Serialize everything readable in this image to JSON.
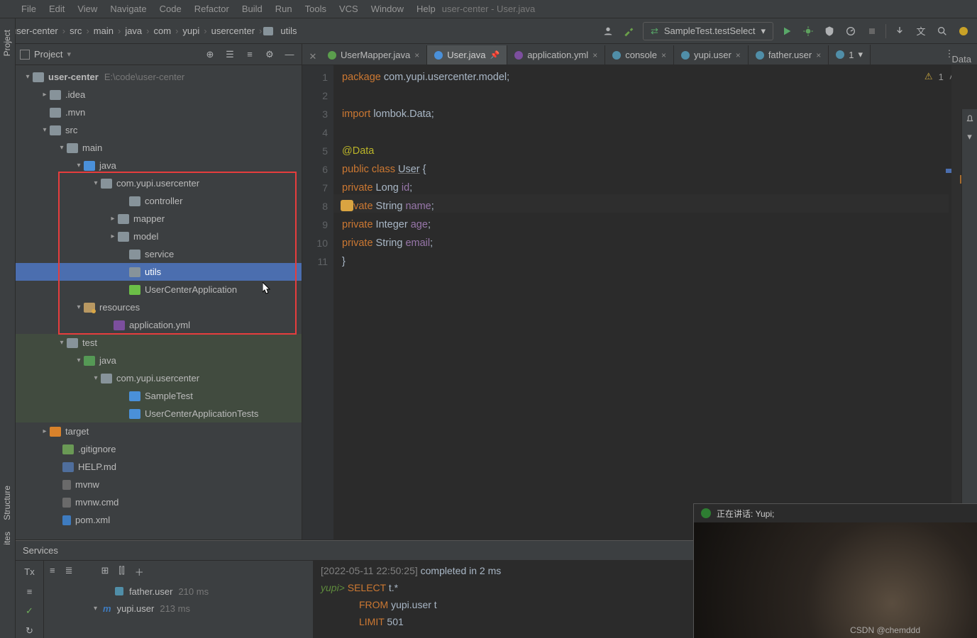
{
  "window_title": "user-center - User.java",
  "menubar": [
    "File",
    "Edit",
    "View",
    "Navigate",
    "Code",
    "Refactor",
    "Build",
    "Run",
    "Tools",
    "VCS",
    "Window",
    "Help"
  ],
  "breadcrumbs": [
    "user-center",
    "src",
    "main",
    "java",
    "com",
    "yupi",
    "usercenter",
    "utils"
  ],
  "run_config": {
    "label": "SampleTest.testSelect"
  },
  "project_panel": {
    "title": "Project",
    "root": {
      "name": "user-center",
      "path": "E:\\code\\user-center"
    }
  },
  "tree": {
    "idea": ".idea",
    "mvn": ".mvn",
    "src": "src",
    "main": "main",
    "java1": "java",
    "pkg1": "com.yupi.usercenter",
    "controller": "controller",
    "mapper": "mapper",
    "model": "model",
    "service": "service",
    "utils": "utils",
    "appclass": "UserCenterApplication",
    "resources": "resources",
    "appyml": "application.yml",
    "test": "test",
    "java2": "java",
    "pkg2": "com.yupi.usercenter",
    "sampletest": "SampleTest",
    "uctests": "UserCenterApplicationTests",
    "target": "target",
    "gitignore": ".gitignore",
    "helpmd": "HELP.md",
    "mvnw": "mvnw",
    "mvnwcmd": "mvnw.cmd",
    "pomxml": "pom.xml"
  },
  "tabs": [
    {
      "label": "UserMapper.java",
      "icon": "ci-i",
      "close": true
    },
    {
      "label": "User.java",
      "icon": "ci-c",
      "active": true,
      "pin": true
    },
    {
      "label": "application.yml",
      "icon": "ci-y",
      "close": true
    },
    {
      "label": "console",
      "icon": "ci-db",
      "close": true
    },
    {
      "label": "yupi.user",
      "icon": "ci-db",
      "close": true
    },
    {
      "label": "father.user",
      "icon": "ci-db",
      "close": true
    },
    {
      "label": "1",
      "icon": "ci-db",
      "dd": true
    }
  ],
  "tabright_label": "Data",
  "editor_warn": {
    "icon": "⚠",
    "count": "1"
  },
  "code": {
    "l1a": "package",
    "l1b": " com.yupi.usercenter.model;",
    "l3a": "import",
    "l3b": " lombok.Data;",
    "l5": "@Data",
    "l6a": "public class ",
    "l6b": "User",
    "l6c": " {",
    "l7a": "    private",
    "l7b": " Long ",
    "l7c": "id",
    "l7d": ";",
    "l8a": "    private",
    "l8b": " String ",
    "l8c": "name",
    "l8d": ";",
    "l9a": "    private",
    "l9b": " Integer ",
    "l9c": "age",
    "l9d": ";",
    "l10a": "    private",
    "l10b": " String ",
    "l10c": "email",
    "l10d": ";",
    "l11": "}"
  },
  "line_numbers": [
    "1",
    "2",
    "3",
    "4",
    "5",
    "6",
    "7",
    "8",
    "9",
    "10",
    "11"
  ],
  "services": {
    "title": "Services",
    "father": {
      "name": "father.user",
      "time": "210 ms"
    },
    "yupi": {
      "name": "yupi.user",
      "time": "213 ms"
    },
    "out_ts": "[2022-05-11 22:50:25]",
    "out_done": " completed in 2 ms",
    "out_prompt": "yupi>",
    "sql_select": "SELECT",
    "sql_tstar": " t.*",
    "sql_from": "FROM",
    "sql_table": " yupi.user t",
    "sql_limit": "LIMIT",
    "sql_n": " 501"
  },
  "left_tabs": {
    "project": "Project",
    "structure": "Structure",
    "ites": "ites"
  },
  "cam": {
    "speaking_label": "正在讲话: Yupi;"
  },
  "watermark": "CSDN @chemddd"
}
